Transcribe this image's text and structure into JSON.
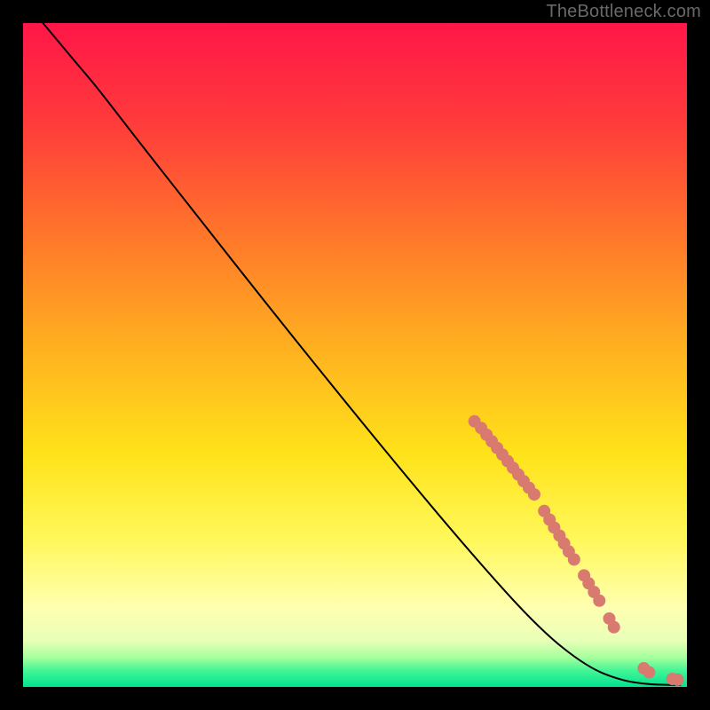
{
  "watermark": "TheBottleneck.com",
  "chart_data": {
    "type": "line",
    "title": "",
    "xlabel": "",
    "ylabel": "",
    "xlim": [
      0,
      100
    ],
    "ylim": [
      0,
      100
    ],
    "gradient_stops": [
      {
        "offset": 0.0,
        "color": "#ff1648"
      },
      {
        "offset": 0.15,
        "color": "#ff3b3b"
      },
      {
        "offset": 0.33,
        "color": "#ff7a2a"
      },
      {
        "offset": 0.5,
        "color": "#ffb41f"
      },
      {
        "offset": 0.65,
        "color": "#ffe31a"
      },
      {
        "offset": 0.78,
        "color": "#fff85c"
      },
      {
        "offset": 0.88,
        "color": "#ffffb0"
      },
      {
        "offset": 0.93,
        "color": "#e8ffb8"
      },
      {
        "offset": 0.955,
        "color": "#a8ff9e"
      },
      {
        "offset": 0.975,
        "color": "#45f596"
      },
      {
        "offset": 1.0,
        "color": "#00e38f"
      }
    ],
    "curve": [
      {
        "x": 3.0,
        "y": 100.0
      },
      {
        "x": 5.5,
        "y": 97.0
      },
      {
        "x": 8.0,
        "y": 94.0
      },
      {
        "x": 11.0,
        "y": 90.5
      },
      {
        "x": 16.0,
        "y": 84.0
      },
      {
        "x": 25.0,
        "y": 72.5
      },
      {
        "x": 40.0,
        "y": 53.5
      },
      {
        "x": 55.0,
        "y": 35.0
      },
      {
        "x": 68.0,
        "y": 19.5
      },
      {
        "x": 78.0,
        "y": 8.5
      },
      {
        "x": 85.0,
        "y": 3.0
      },
      {
        "x": 90.0,
        "y": 1.0
      },
      {
        "x": 94.0,
        "y": 0.4
      },
      {
        "x": 97.0,
        "y": 0.3
      },
      {
        "x": 99.0,
        "y": 0.3
      }
    ],
    "markers": [
      {
        "x": 68.0,
        "y": 40.0
      },
      {
        "x": 69.0,
        "y": 39.0
      },
      {
        "x": 69.8,
        "y": 38.0
      },
      {
        "x": 70.6,
        "y": 37.0
      },
      {
        "x": 71.4,
        "y": 36.0
      },
      {
        "x": 72.2,
        "y": 35.0
      },
      {
        "x": 73.0,
        "y": 34.0
      },
      {
        "x": 73.8,
        "y": 33.0
      },
      {
        "x": 74.6,
        "y": 32.0
      },
      {
        "x": 75.4,
        "y": 31.0
      },
      {
        "x": 76.2,
        "y": 30.0
      },
      {
        "x": 77.0,
        "y": 29.0
      },
      {
        "x": 78.5,
        "y": 26.5
      },
      {
        "x": 79.3,
        "y": 25.2
      },
      {
        "x": 80.0,
        "y": 24.0
      },
      {
        "x": 80.8,
        "y": 22.8
      },
      {
        "x": 81.5,
        "y": 21.6
      },
      {
        "x": 82.2,
        "y": 20.4
      },
      {
        "x": 83.0,
        "y": 19.2
      },
      {
        "x": 84.5,
        "y": 16.8
      },
      {
        "x": 85.2,
        "y": 15.6
      },
      {
        "x": 86.0,
        "y": 14.3
      },
      {
        "x": 86.8,
        "y": 13.0
      },
      {
        "x": 88.3,
        "y": 10.3
      },
      {
        "x": 89.0,
        "y": 9.0
      },
      {
        "x": 93.5,
        "y": 2.8
      },
      {
        "x": 94.3,
        "y": 2.2
      },
      {
        "x": 97.8,
        "y": 1.2
      },
      {
        "x": 98.6,
        "y": 1.1
      }
    ],
    "marker_color": "#d87a6f",
    "curve_color": "#000000"
  }
}
